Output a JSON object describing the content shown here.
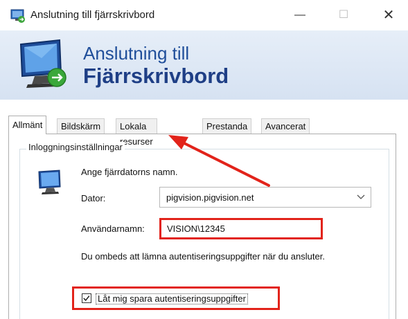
{
  "window": {
    "title": "Anslutning till fjärrskrivbord",
    "controls": {
      "minimize": "—",
      "maximize": "☐",
      "close": "✕"
    }
  },
  "banner": {
    "line1": "Anslutning till",
    "line2": "Fjärrskrivbord"
  },
  "tabs": [
    {
      "label": "Allmänt",
      "active": true
    },
    {
      "label": "Bildskärm",
      "active": false
    },
    {
      "label": "Lokala resurser",
      "active": false
    },
    {
      "label": "Prestanda",
      "active": false
    },
    {
      "label": "Avancerat",
      "active": false
    }
  ],
  "login": {
    "legend": "Inloggningsinställningar",
    "prompt": "Ange fjärrdatorns namn.",
    "computer_label": "Dator:",
    "computer_value": "pigvision.pigvision.net",
    "username_label": "Användarnamn:",
    "username_value": "VISION\\12345",
    "info_text": "Du ombeds att lämna autentiseringsuppgifter när du ansluter.",
    "save_credentials_label": "Låt mig spara autentiseringsuppgifter",
    "save_credentials_checked": true
  },
  "colors": {
    "highlight": "#e2231a",
    "banner_text": "#1f3f86"
  }
}
